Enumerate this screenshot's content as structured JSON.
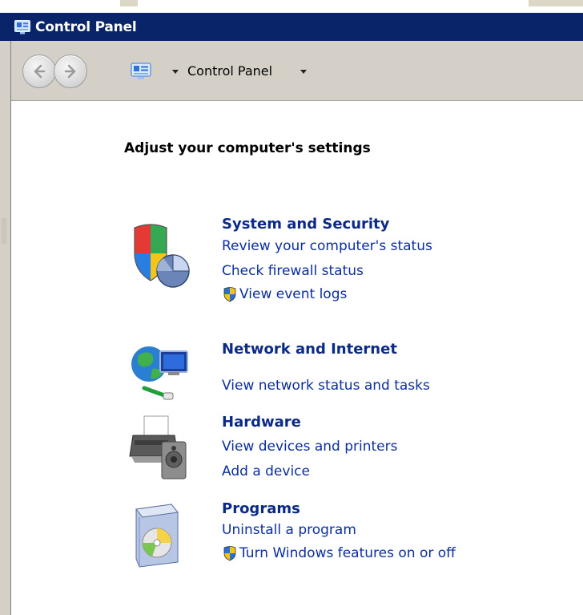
{
  "window": {
    "title": "Control Panel"
  },
  "toolbar": {
    "breadcrumb": "Control Panel"
  },
  "main": {
    "heading": "Adjust your computer's settings",
    "categories": [
      {
        "title": "System and Security",
        "icon": "shield-pie-icon",
        "links": [
          {
            "label": "Review your computer's status"
          },
          {
            "label": "Check firewall status"
          },
          {
            "label": "View event logs",
            "shield": true
          }
        ]
      },
      {
        "title": "Network and Internet",
        "icon": "globe-network-icon",
        "links": [
          {
            "label": "View network status and tasks"
          }
        ]
      },
      {
        "title": "Hardware",
        "icon": "printer-speaker-icon",
        "links": [
          {
            "label": "View devices and printers"
          },
          {
            "label": "Add a device"
          }
        ]
      },
      {
        "title": "Programs",
        "icon": "programs-disc-icon",
        "links": [
          {
            "label": "Uninstall a program"
          },
          {
            "label": "Turn Windows features on or off",
            "shield": true
          }
        ]
      }
    ]
  },
  "colors": {
    "titlebar": "#0a246a",
    "link": "#0c2fa0",
    "category_title": "#0b2a86",
    "chrome": "#d4d0c8"
  }
}
